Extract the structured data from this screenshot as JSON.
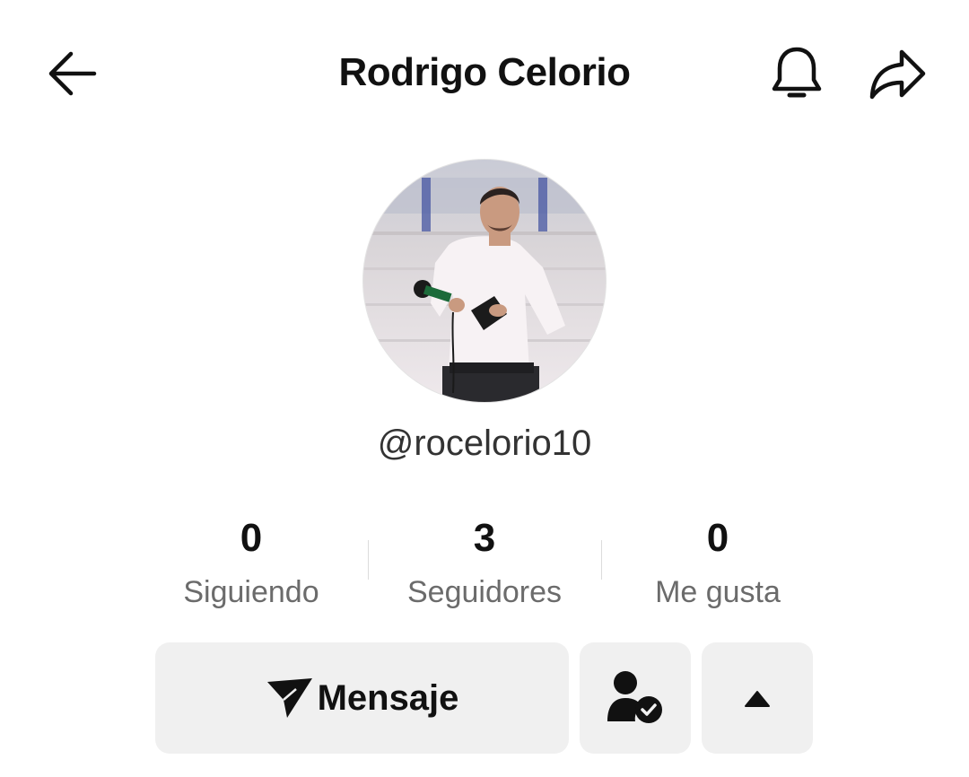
{
  "header": {
    "title": "Rodrigo Celorio",
    "back_icon": "arrow-left-icon",
    "notify_icon": "bell-icon",
    "share_icon": "share-arrow-icon"
  },
  "profile": {
    "username": "@rocelorio10"
  },
  "stats": [
    {
      "value": "0",
      "label": "Siguiendo"
    },
    {
      "value": "3",
      "label": "Seguidores"
    },
    {
      "value": "0",
      "label": "Me gusta"
    }
  ],
  "actions": {
    "message_label": "Mensaje",
    "message_icon": "paper-plane-icon",
    "following_icon": "user-check-icon",
    "more_icon": "triangle-up-icon"
  },
  "colors": {
    "button_bg": "#f0f0f0",
    "text_primary": "#111111",
    "text_secondary": "#6b6b6b"
  }
}
